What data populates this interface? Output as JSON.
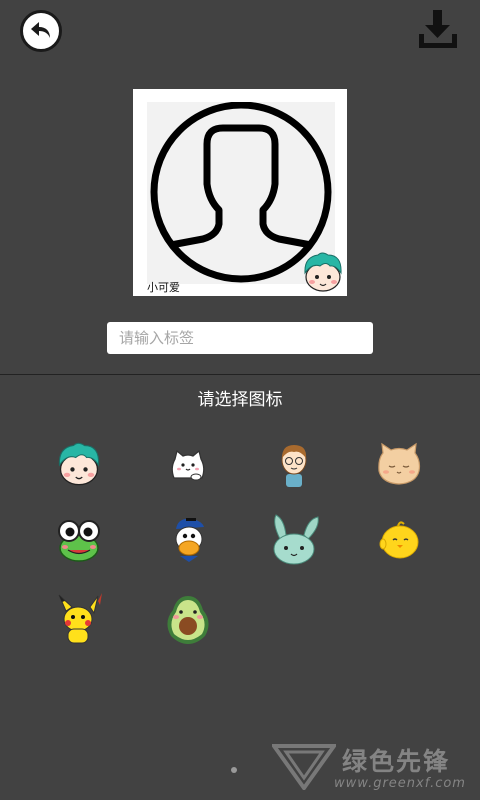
{
  "header": {
    "back_icon": "back-arrow-icon",
    "download_icon": "download-icon"
  },
  "preview": {
    "avatar_icon": "default-user-avatar-icon",
    "caption": "小可爱",
    "selected_sticker": "green-hair-boy"
  },
  "tag_input": {
    "value": "",
    "placeholder": "请输入标签"
  },
  "picker": {
    "title": "请选择图标",
    "icons": [
      {
        "name": "green-hair-boy"
      },
      {
        "name": "white-cat"
      },
      {
        "name": "boy-with-glasses"
      },
      {
        "name": "orange-cat"
      },
      {
        "name": "green-frog"
      },
      {
        "name": "donald-duck"
      },
      {
        "name": "mint-rabbit"
      },
      {
        "name": "yellow-chick"
      },
      {
        "name": "pikachu"
      },
      {
        "name": "avocado"
      }
    ]
  },
  "pager": {
    "current_page": 1,
    "page_count": 1
  },
  "watermark": {
    "brand": "绿色先锋",
    "url": "www.greenxf.com"
  },
  "colors": {
    "background": "#424242",
    "panel": "#ffffff",
    "text": "#ffffff"
  }
}
